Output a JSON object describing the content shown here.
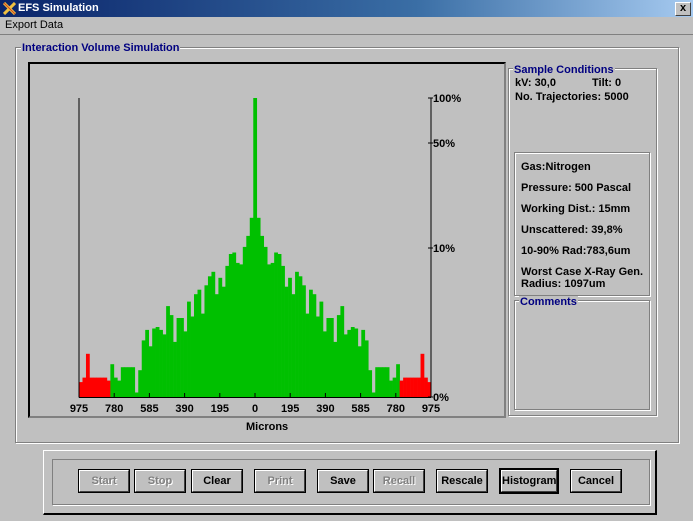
{
  "window": {
    "title": "EFS Simulation",
    "close_label": "x"
  },
  "menu": {
    "items": [
      {
        "label": "Export Data",
        "accel": "x"
      }
    ]
  },
  "simulation_group": {
    "label": "Interaction Volume Simulation"
  },
  "sample_conditions": {
    "label": "Sample Conditions",
    "kv": "kV: 30,0",
    "tilt": "Tilt:  0",
    "trajectories": "No. Trajectories: 5000"
  },
  "parameters": {
    "gas": "Gas:Nitrogen",
    "pressure": "Pressure:  500 Pascal",
    "working_dist": "Working Dist.:  15mm",
    "unscattered": "Unscattered: 39,8%",
    "rad": "10-90% Rad:783,6um",
    "worst_case_1": "Worst Case X-Ray Gen.",
    "worst_case_2": "Radius: 1097um"
  },
  "comments": {
    "label": "Comments",
    "text": ""
  },
  "buttons": [
    {
      "label": "Start",
      "enabled": false
    },
    {
      "label": "Stop",
      "enabled": false
    },
    {
      "label": "Clear",
      "enabled": true
    },
    {
      "label": "Print",
      "enabled": false
    },
    {
      "label": "Save",
      "enabled": true
    },
    {
      "label": "Recall",
      "enabled": false
    },
    {
      "label": "Rescale",
      "enabled": true
    },
    {
      "label": "Histogram",
      "enabled": true,
      "default": true
    },
    {
      "label": "Cancel",
      "enabled": true
    }
  ],
  "colors": {
    "inner": "#00c000",
    "outer": "#ff0000",
    "label": "#000080"
  },
  "chart_data": {
    "type": "bar",
    "title": "",
    "xlabel": "Microns",
    "ylabel": "",
    "x_tick_labels": [
      "975",
      "780",
      "585",
      "390",
      "195",
      "0",
      "195",
      "390",
      "585",
      "780",
      "975"
    ],
    "y_ticks": [
      {
        "value": 0,
        "label": "0%"
      },
      {
        "value": 10,
        "label": "10%"
      },
      {
        "value": 50,
        "label": "50%"
      },
      {
        "value": 100,
        "label": "100%"
      }
    ],
    "ylim": [
      0,
      100
    ],
    "y_scale": "piecewise (0-10 compressed linear, 10-50, 50-100)",
    "red_bins_per_side": 9,
    "values_left_outer_to_center": [
      1.0,
      1.3,
      2.9,
      1.3,
      1.3,
      1.3,
      1.3,
      1.3,
      1.1,
      2.2,
      1.3,
      1.1,
      2.0,
      2.0,
      2.0,
      2.0,
      0.3,
      1.8,
      3.8,
      4.5,
      3.4,
      4.6,
      4.7,
      4.5,
      4.2,
      6.1,
      5.5,
      3.7,
      5.3,
      5.3,
      4.4,
      6.4,
      5.4,
      6.9,
      7.2,
      5.6,
      7.5,
      8.1,
      8.4,
      6.9,
      8.0,
      7.4,
      8.8,
      9.6,
      9.7,
      9.0,
      8.9,
      10.4,
      14.6,
      21.5
    ],
    "center_value": 100,
    "values_center_to_right_outer": [
      21.5,
      14.6,
      10.4,
      8.9,
      9.0,
      9.7,
      9.6,
      8.8,
      7.4,
      8.0,
      6.9,
      8.4,
      8.1,
      7.5,
      5.6,
      7.2,
      6.9,
      5.4,
      6.4,
      4.4,
      5.3,
      5.3,
      3.7,
      5.5,
      6.1,
      4.2,
      4.5,
      4.7,
      4.6,
      3.4,
      4.5,
      3.8,
      1.8,
      0.3,
      2.0,
      2.0,
      2.0,
      2.0,
      1.1,
      1.3,
      2.2,
      1.1,
      1.3,
      1.3,
      1.3,
      1.3,
      1.3,
      2.9,
      1.3,
      1.0
    ]
  }
}
